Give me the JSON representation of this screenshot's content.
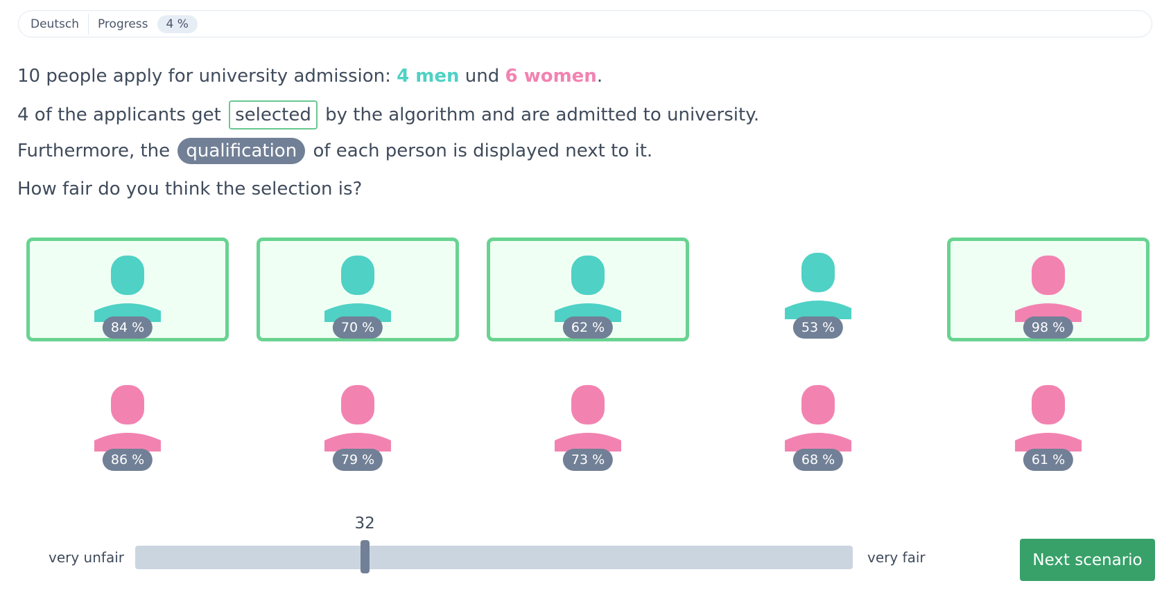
{
  "topbar": {
    "language": "Deutsch",
    "progress_label": "Progress",
    "progress_value": "4 %"
  },
  "intro": {
    "line1_prefix": "10 people apply for university admission: ",
    "men": "4 men",
    "und": " und ",
    "women": "6 women",
    "line1_suffix": ".",
    "line2_prefix": "4 of the applicants get ",
    "selected": "selected",
    "line2_suffix": " by the algorithm and are admitted to university.",
    "line3_prefix": "Furthermore, the ",
    "qualification": "qualification",
    "line3_suffix": " of each person is displayed next to it.",
    "question": "How fair do you think the selection is?"
  },
  "people": [
    {
      "gender": "man",
      "qualification": "84 %",
      "selected": true
    },
    {
      "gender": "man",
      "qualification": "70 %",
      "selected": true
    },
    {
      "gender": "man",
      "qualification": "62 %",
      "selected": true
    },
    {
      "gender": "man",
      "qualification": "53 %",
      "selected": false
    },
    {
      "gender": "woman",
      "qualification": "98 %",
      "selected": true
    },
    {
      "gender": "woman",
      "qualification": "86 %",
      "selected": false
    },
    {
      "gender": "woman",
      "qualification": "79 %",
      "selected": false
    },
    {
      "gender": "woman",
      "qualification": "73 %",
      "selected": false
    },
    {
      "gender": "woman",
      "qualification": "68 %",
      "selected": false
    },
    {
      "gender": "woman",
      "qualification": "61 %",
      "selected": false
    }
  ],
  "colors": {
    "man": "#4fd1c5",
    "woman": "#f283b1",
    "selected_border": "#68d391",
    "badge": "#718096",
    "button": "#38a169"
  },
  "slider": {
    "left_label": "very unfair",
    "right_label": "very fair",
    "value": "32",
    "value_fraction": 0.32
  },
  "next_button": "Next scenario"
}
